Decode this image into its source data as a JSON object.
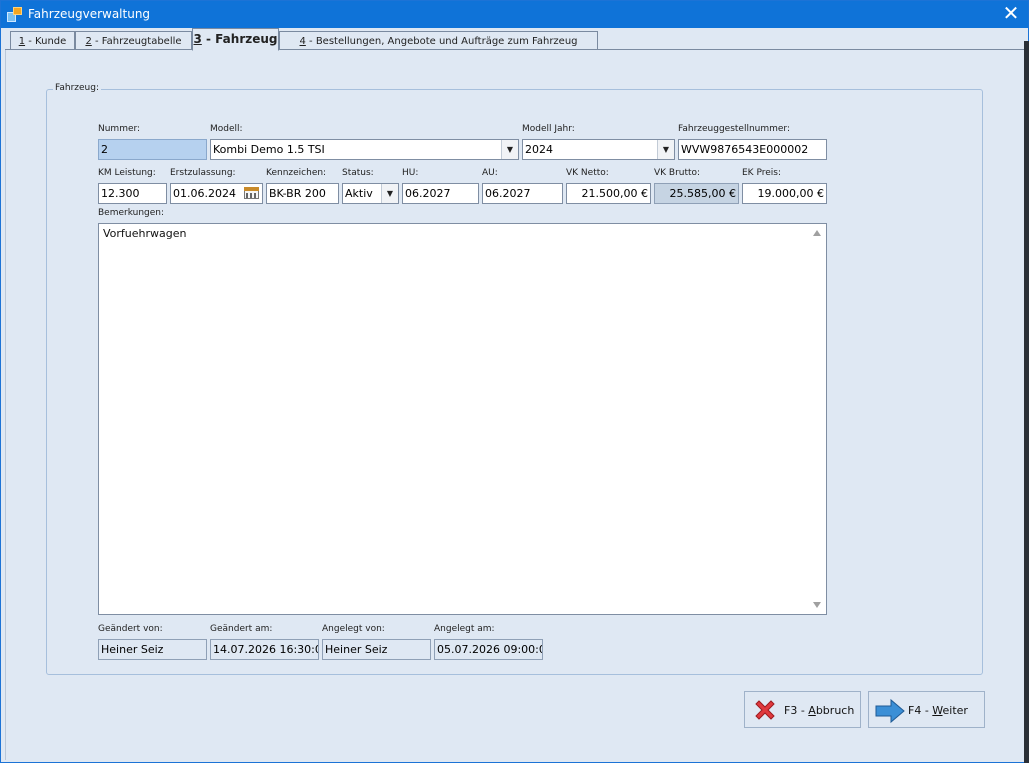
{
  "window": {
    "title": "Fahrzeugverwaltung",
    "close_glyph": "✕"
  },
  "tabs": [
    {
      "key": "1",
      "label": " - Kunde"
    },
    {
      "key": "2",
      "label": " - Fahrzeugtabelle"
    },
    {
      "key": "3",
      "label": " - Fahrzeug",
      "active": true
    },
    {
      "key": "4",
      "label": " - Bestellungen, Angebote und Aufträge zum Fahrzeug"
    }
  ],
  "group": {
    "title": "Fahrzeug:"
  },
  "labels": {
    "nummer": "Nummer:",
    "modell": "Modell:",
    "modell_jahr": "Modell Jahr:",
    "fahrgestell": "Fahrzeuggestellnummer:",
    "km": "KM Leistung:",
    "erstzulassung": "Erstzulassung:",
    "kennzeichen": "Kennzeichen:",
    "status": "Status:",
    "hu": "HU:",
    "au": "AU:",
    "vk_netto": "VK Netto:",
    "vk_brutto": "VK Brutto:",
    "ek_preis": "EK Preis:",
    "bemerkungen": "Bemerkungen:",
    "geaendert_von": "Geändert von:",
    "geaendert_am": "Geändert am:",
    "angelegt_von": "Angelegt von:",
    "angelegt_am": "Angelegt am:"
  },
  "values": {
    "nummer": "2",
    "modell": "Kombi Demo 1.5 TSI",
    "modell_jahr": "2024",
    "fahrgestell": "WVW9876543E000002",
    "km": "12.300",
    "erstzulassung": "01.06.2024",
    "kennzeichen": "BK-BR 200",
    "status": "Aktiv",
    "hu": "06.2027",
    "au": "06.2027",
    "vk_netto": "21.500,00 €",
    "vk_brutto": "25.585,00 €",
    "ek_preis": "19.000,00 €",
    "bemerkungen": "Vorfuehrwagen",
    "geaendert_von": "Heiner Seiz",
    "geaendert_am": "14.07.2026 16:30:0",
    "angelegt_von": "Heiner Seiz",
    "angelegt_am": "05.07.2026 09:00:0"
  },
  "buttons": {
    "abbruch_prefix": "F3 - ",
    "abbruch_key": "A",
    "abbruch_rest": "bbruch",
    "weiter_prefix": "F4 - ",
    "weiter_key": "W",
    "weiter_rest": "eiter"
  },
  "icons": {
    "dropdown": "▼",
    "cancel": "red-x-icon",
    "next": "blue-arrow-right-icon",
    "calendar": "calendar-icon"
  },
  "colors": {
    "titlebar": "#0f73d8",
    "window_bg": "#dfe8f3",
    "selected_field": "#b6d1ef",
    "cancel_red": "#e0393e",
    "arrow_blue": "#3b8fd6"
  }
}
